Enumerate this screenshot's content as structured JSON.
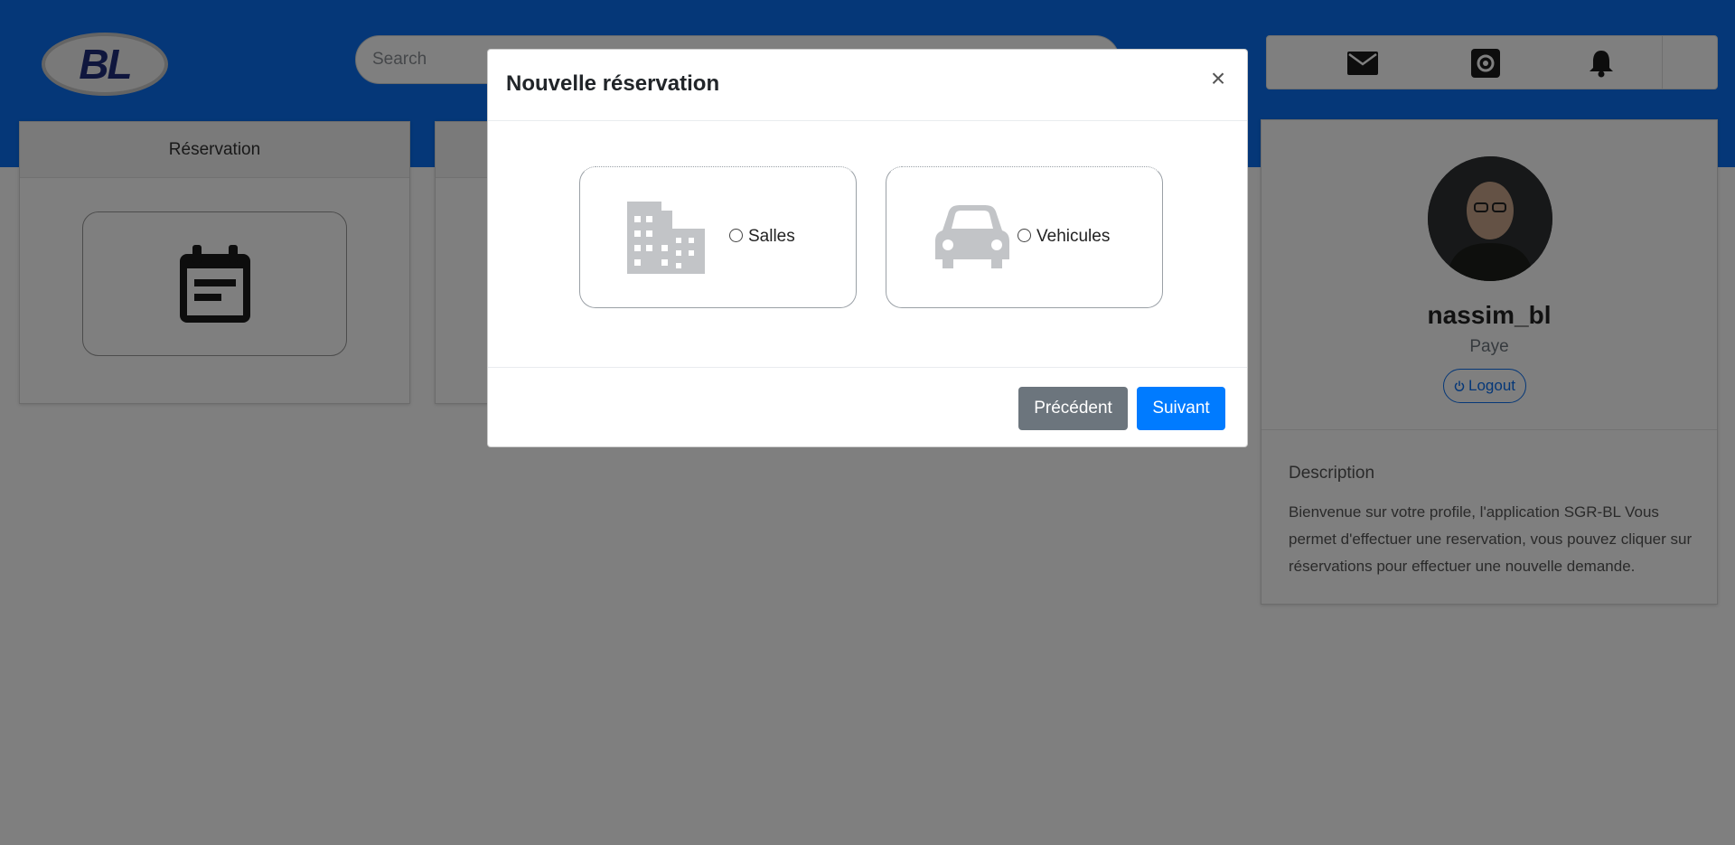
{
  "header": {
    "logo_text": "BL",
    "search": {
      "placeholder": "Search",
      "value": ""
    },
    "icons": [
      "mail-icon",
      "gear-icon",
      "bell-icon"
    ]
  },
  "cards": {
    "reservation": {
      "title": "Réservation",
      "icon": "calendar-icon"
    }
  },
  "profile": {
    "username": "nassim_bl",
    "role": "Paye",
    "logout_icon": "power-icon",
    "logout_label": "Logout",
    "description_title": "Description",
    "description_text": "Bienvenue sur votre profile, l'application SGR-BL Vous permet d'effectuer une reservation, vous pouvez cliquer sur réservations pour effectuer une nouvelle demande."
  },
  "modal": {
    "title": "Nouvelle réservation",
    "close_label": "×",
    "options": [
      {
        "label": "Salles",
        "icon": "building-icon",
        "selected": false
      },
      {
        "label": "Vehicules",
        "icon": "car-icon",
        "selected": false
      }
    ],
    "buttons": {
      "previous": "Précédent",
      "next": "Suivant"
    }
  },
  "colors": {
    "brand_blue": "#0a6ff0",
    "primary": "#007bff",
    "secondary": "#6c757d"
  }
}
